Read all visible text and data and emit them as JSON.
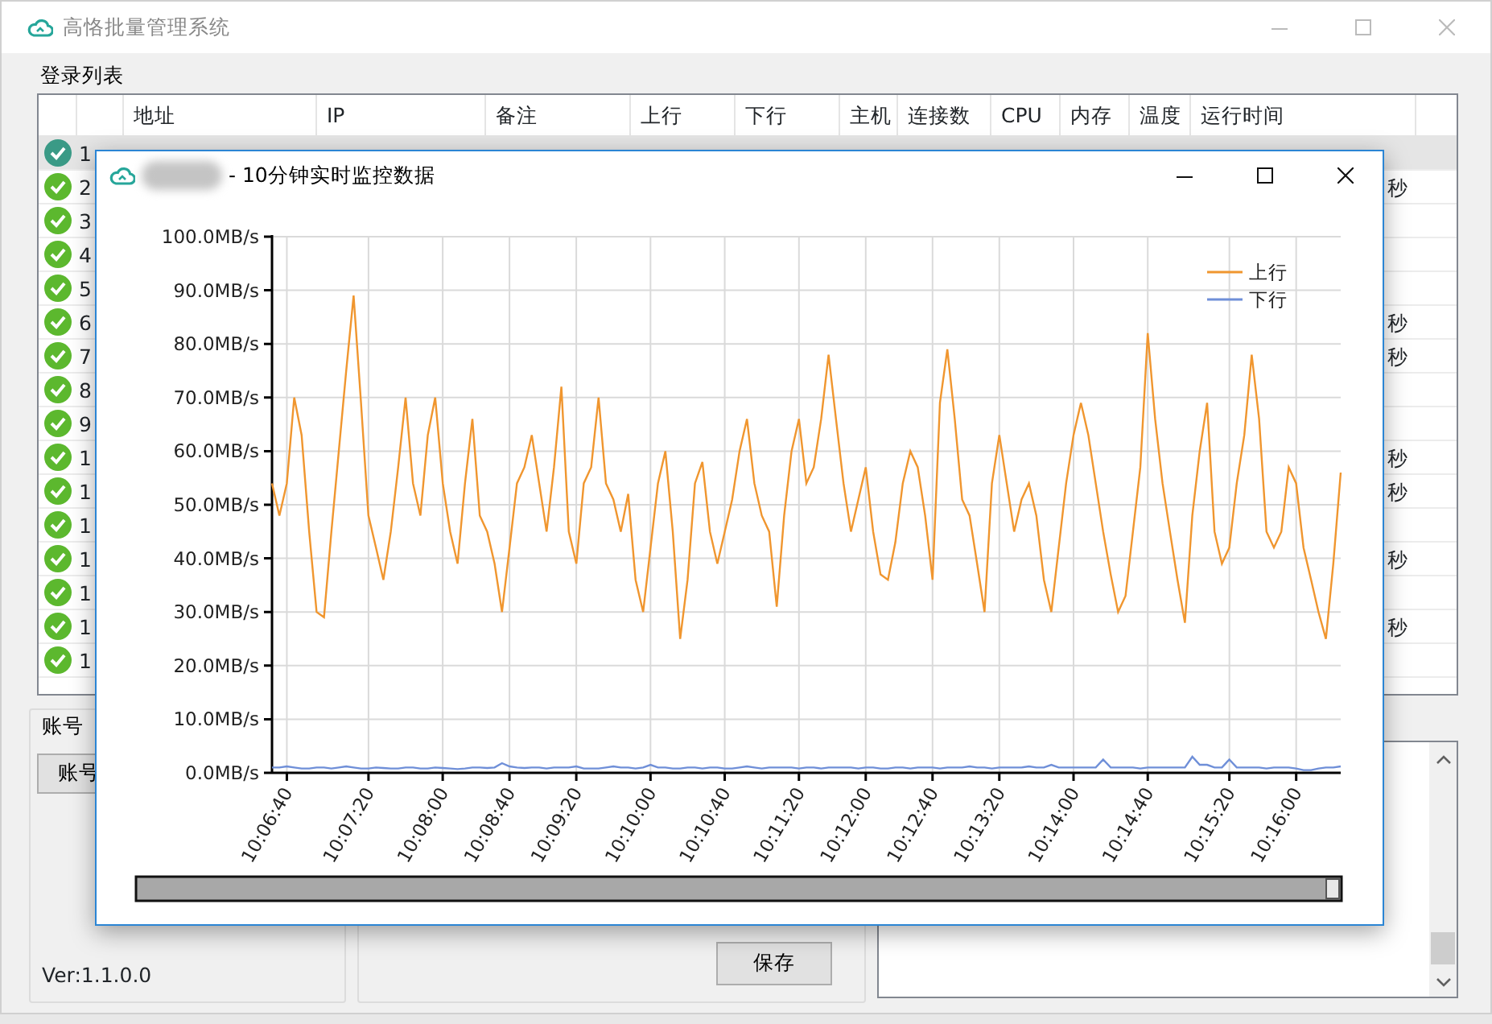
{
  "main_window": {
    "title": "高恪批量管理系统"
  },
  "login_list": {
    "title": "登录列表",
    "columns": [
      "地址",
      "IP",
      "备注",
      "上行",
      "下行",
      "主机",
      "连接数",
      "CPU",
      "内存",
      "温度",
      "运行时间"
    ],
    "rows": [
      {
        "number": "1",
        "online": true,
        "selected": true
      },
      {
        "number": "2",
        "online": true,
        "selected": false,
        "runtime": "秒"
      },
      {
        "number": "3",
        "online": true,
        "selected": false
      },
      {
        "number": "4",
        "online": true,
        "selected": false
      },
      {
        "number": "5",
        "online": true,
        "selected": false
      },
      {
        "number": "6",
        "online": true,
        "selected": false,
        "runtime": "秒"
      },
      {
        "number": "7",
        "online": true,
        "selected": false,
        "runtime": "秒"
      },
      {
        "number": "8",
        "online": true,
        "selected": false
      },
      {
        "number": "9",
        "online": true,
        "selected": false
      },
      {
        "number": "1",
        "online": true,
        "selected": false,
        "runtime": "秒"
      },
      {
        "number": "1",
        "online": true,
        "selected": false,
        "runtime": "秒"
      },
      {
        "number": "1",
        "online": true,
        "selected": false
      },
      {
        "number": "1",
        "online": true,
        "selected": false,
        "runtime": "秒"
      },
      {
        "number": "1",
        "online": true,
        "selected": false
      },
      {
        "number": "1",
        "online": true,
        "selected": false,
        "runtime": "秒"
      },
      {
        "number": "1",
        "online": true,
        "selected": false
      }
    ]
  },
  "account_group": {
    "title": "账号",
    "button": "账号",
    "version": "Ver:1.1.0.0"
  },
  "save_button": "保存",
  "monitor_window": {
    "title": "- 10分钟实时监控数据",
    "chart_data": {
      "type": "line",
      "grid": true,
      "legend": true,
      "ylim": [
        0,
        100
      ],
      "yticks": [
        {
          "value": 0,
          "label": "0.0MB/s"
        },
        {
          "value": 10,
          "label": "10.0MB/s"
        },
        {
          "value": 20,
          "label": "20.0MB/s"
        },
        {
          "value": 30,
          "label": "30.0MB/s"
        },
        {
          "value": 40,
          "label": "40.0MB/s"
        },
        {
          "value": 50,
          "label": "50.0MB/s"
        },
        {
          "value": 60,
          "label": "60.0MB/s"
        },
        {
          "value": 70,
          "label": "70.0MB/s"
        },
        {
          "value": 80,
          "label": "80.0MB/s"
        },
        {
          "value": 90,
          "label": "90.0MB/s"
        },
        {
          "value": 100,
          "label": "100.0MB/s"
        }
      ],
      "categories": [
        null,
        null,
        "10:06:40",
        null,
        null,
        null,
        null,
        null,
        null,
        null,
        null,
        null,
        null,
        "10:07:20",
        null,
        null,
        null,
        null,
        null,
        null,
        null,
        null,
        null,
        "10:08:00",
        null,
        null,
        null,
        null,
        null,
        null,
        null,
        null,
        "10:08:40",
        null,
        null,
        null,
        null,
        null,
        null,
        null,
        null,
        "10:09:20",
        null,
        null,
        null,
        null,
        null,
        null,
        null,
        null,
        null,
        "10:10:00",
        null,
        null,
        null,
        null,
        null,
        null,
        null,
        null,
        null,
        "10:10:40",
        null,
        null,
        null,
        null,
        null,
        null,
        null,
        null,
        null,
        "10:11:20",
        null,
        null,
        null,
        null,
        null,
        null,
        null,
        null,
        "10:12:00",
        null,
        null,
        null,
        null,
        null,
        null,
        null,
        null,
        "10:12:40",
        null,
        null,
        null,
        null,
        null,
        null,
        null,
        null,
        "10:13:20",
        null,
        null,
        null,
        null,
        null,
        null,
        null,
        null,
        null,
        "10:14:00",
        null,
        null,
        null,
        null,
        null,
        null,
        null,
        null,
        null,
        "10:14:40",
        null,
        null,
        null,
        null,
        null,
        null,
        null,
        null,
        null,
        null,
        "10:15:20",
        null,
        null,
        null,
        null,
        null,
        null,
        null,
        null,
        "10:16:00",
        null,
        null,
        null,
        null,
        null,
        null
      ],
      "series": [
        {
          "name": "上行",
          "color": "#f0962f",
          "values": [
            54,
            48,
            54,
            70,
            63,
            45,
            30,
            29,
            45,
            60,
            75,
            89,
            69,
            48,
            42,
            36,
            45,
            57,
            70,
            54,
            48,
            63,
            70,
            54,
            45,
            39,
            54,
            66,
            48,
            45,
            39,
            30,
            42,
            54,
            57,
            63,
            54,
            45,
            57,
            72,
            45,
            39,
            54,
            57,
            70,
            54,
            51,
            45,
            52,
            36,
            30,
            42,
            54,
            60,
            45,
            25,
            36,
            54,
            58,
            45,
            39,
            45,
            51,
            60,
            66,
            54,
            48,
            45,
            31,
            48,
            60,
            66,
            54,
            57,
            66,
            78,
            66,
            54,
            45,
            51,
            57,
            45,
            37,
            36,
            43,
            54,
            60,
            57,
            48,
            36,
            69,
            79,
            66,
            51,
            48,
            39,
            30,
            54,
            63,
            54,
            45,
            51,
            54,
            48,
            36,
            30,
            42,
            54,
            63,
            69,
            63,
            54,
            45,
            37,
            30,
            33,
            45,
            57,
            82,
            66,
            54,
            45,
            36,
            28,
            48,
            60,
            69,
            45,
            39,
            42,
            54,
            63,
            78,
            66,
            45,
            42,
            45,
            57,
            54,
            42,
            36,
            30,
            25,
            39,
            56
          ]
        },
        {
          "name": "下行",
          "color": "#6f8fd8",
          "values": [
            1,
            1,
            1.2,
            1,
            0.8,
            0.8,
            1,
            1,
            0.8,
            1,
            1.2,
            1,
            0.8,
            0.8,
            1,
            0.9,
            0.8,
            0.8,
            1,
            1,
            0.8,
            0.8,
            1,
            0.9,
            0.8,
            0.7,
            0.8,
            1,
            1,
            0.9,
            1,
            1.8,
            1.2,
            1,
            0.9,
            1,
            1,
            0.8,
            1,
            1,
            1,
            1.2,
            0.8,
            0.8,
            0.8,
            1,
            1.2,
            1,
            1,
            0.8,
            1,
            1.5,
            1,
            1,
            0.8,
            0.8,
            1,
            1,
            0.8,
            1,
            1,
            0.8,
            0.8,
            1,
            1.2,
            1,
            0.8,
            1,
            1,
            1,
            1,
            0.8,
            1,
            1,
            0.8,
            1,
            1,
            1,
            1,
            0.8,
            1,
            1,
            0.8,
            0.8,
            1,
            1,
            0.8,
            1,
            1,
            1,
            0.8,
            1,
            1,
            1,
            1.2,
            1,
            1,
            0.8,
            1,
            1,
            1,
            1,
            1.2,
            1,
            1,
            1.5,
            1,
            1,
            1,
            1,
            1,
            1,
            2.5,
            1,
            1,
            1,
            1,
            0.8,
            1,
            1,
            1,
            1,
            1,
            1,
            3,
            1.5,
            1.5,
            1,
            1,
            2.5,
            1,
            1,
            1,
            1,
            0.8,
            1,
            1,
            1,
            0.8,
            0.5,
            0.5,
            0.8,
            1,
            1,
            1.2
          ]
        }
      ]
    }
  }
}
